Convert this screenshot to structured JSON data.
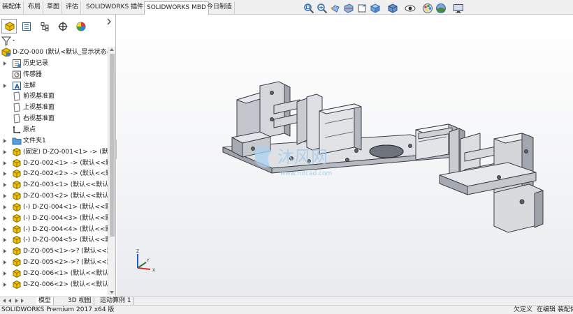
{
  "command_tabs": [
    "装配体",
    "布局",
    "草图",
    "评估",
    "SOLIDWORKS 插件",
    "SOLIDWORKS MBD",
    "今日制造"
  ],
  "active_command_tab": "SOLIDWORKS MBD",
  "heads_up_toolbar": [
    "zoom-to-fit-icon",
    "zoom-to-area-icon",
    "previous-view-icon",
    "section-view-icon",
    "dynamic-annotation-icon",
    "view-orientation-icon",
    "display-style-icon",
    "hide-show-icon",
    "appearance-icon",
    "scene-icon",
    "view-settings-icon"
  ],
  "manager_tabs": [
    "featuremanager-icon",
    "propertymanager-icon",
    "configurationmanager-icon",
    "dimxpert-icon",
    "display-manager-icon"
  ],
  "tree": {
    "root": "D-ZQ-000  (默认<默认_显示状态-",
    "items": [
      {
        "label": "历史记录",
        "icon": "history-icon",
        "expandable": true
      },
      {
        "label": "传感器",
        "icon": "sensor-icon",
        "expandable": false
      },
      {
        "label": "注解",
        "icon": "annotation-icon",
        "expandable": true
      },
      {
        "label": "前视基准面",
        "icon": "plane-icon",
        "expandable": false
      },
      {
        "label": "上视基准面",
        "icon": "plane-icon",
        "expandable": false
      },
      {
        "label": "右视基准面",
        "icon": "plane-icon",
        "expandable": false
      },
      {
        "label": "原点",
        "icon": "origin-icon",
        "expandable": false
      },
      {
        "label": "文件夹1",
        "icon": "folder-icon",
        "expandable": true
      },
      {
        "label": "(固定) D-ZQ-001<1> -> (默认",
        "icon": "part-icon",
        "expandable": true
      },
      {
        "label": "D-ZQ-002<1> -> (默认<<默",
        "icon": "part-icon",
        "expandable": true
      },
      {
        "label": "D-ZQ-002<2> -> (默认<<默",
        "icon": "part-icon",
        "expandable": true
      },
      {
        "label": "D-ZQ-003<1> (默认<<默认>",
        "icon": "part-icon",
        "expandable": true
      },
      {
        "label": "D-ZQ-003<2> (默认<<默认>",
        "icon": "part-icon",
        "expandable": true
      },
      {
        "label": "(-) D-ZQ-004<1> (默认<<默",
        "icon": "part-icon",
        "expandable": true
      },
      {
        "label": "(-) D-ZQ-004<3> (默认<<默",
        "icon": "part-icon",
        "expandable": true
      },
      {
        "label": "(-) D-ZQ-004<4> (默认<<默",
        "icon": "part-icon",
        "expandable": true
      },
      {
        "label": "(-) D-ZQ-004<5> (默认<<默",
        "icon": "part-icon",
        "expandable": true
      },
      {
        "label": "D-ZQ-005<1>->? (默认<<默",
        "icon": "part-icon",
        "expandable": true
      },
      {
        "label": "D-ZQ-005<2>->? (默认<<默",
        "icon": "part-icon",
        "expandable": true
      },
      {
        "label": "D-ZQ-006<1> (默认<<默认>",
        "icon": "part-icon",
        "expandable": true
      },
      {
        "label": "D-ZQ-006<2> (默认<<默认>",
        "icon": "part-icon",
        "expandable": true
      }
    ]
  },
  "watermark": {
    "big": "沐风网",
    "small": "www.mfcad.com"
  },
  "triad": {
    "x": "X",
    "y": "Y",
    "z": "Z"
  },
  "bottom_tabs": [
    "模型",
    "3D 视图",
    "运动算例 1"
  ],
  "active_bottom_tab": "模型",
  "status": {
    "product": "SOLIDWORKS Premium 2017 x64 版",
    "under_defined": "欠定义",
    "editing": "在编辑 装配体"
  },
  "colors": {
    "accent_blue": "#1f6fc4",
    "part_yellow": "#e8b800",
    "model_gray": "#c9cbd0"
  }
}
